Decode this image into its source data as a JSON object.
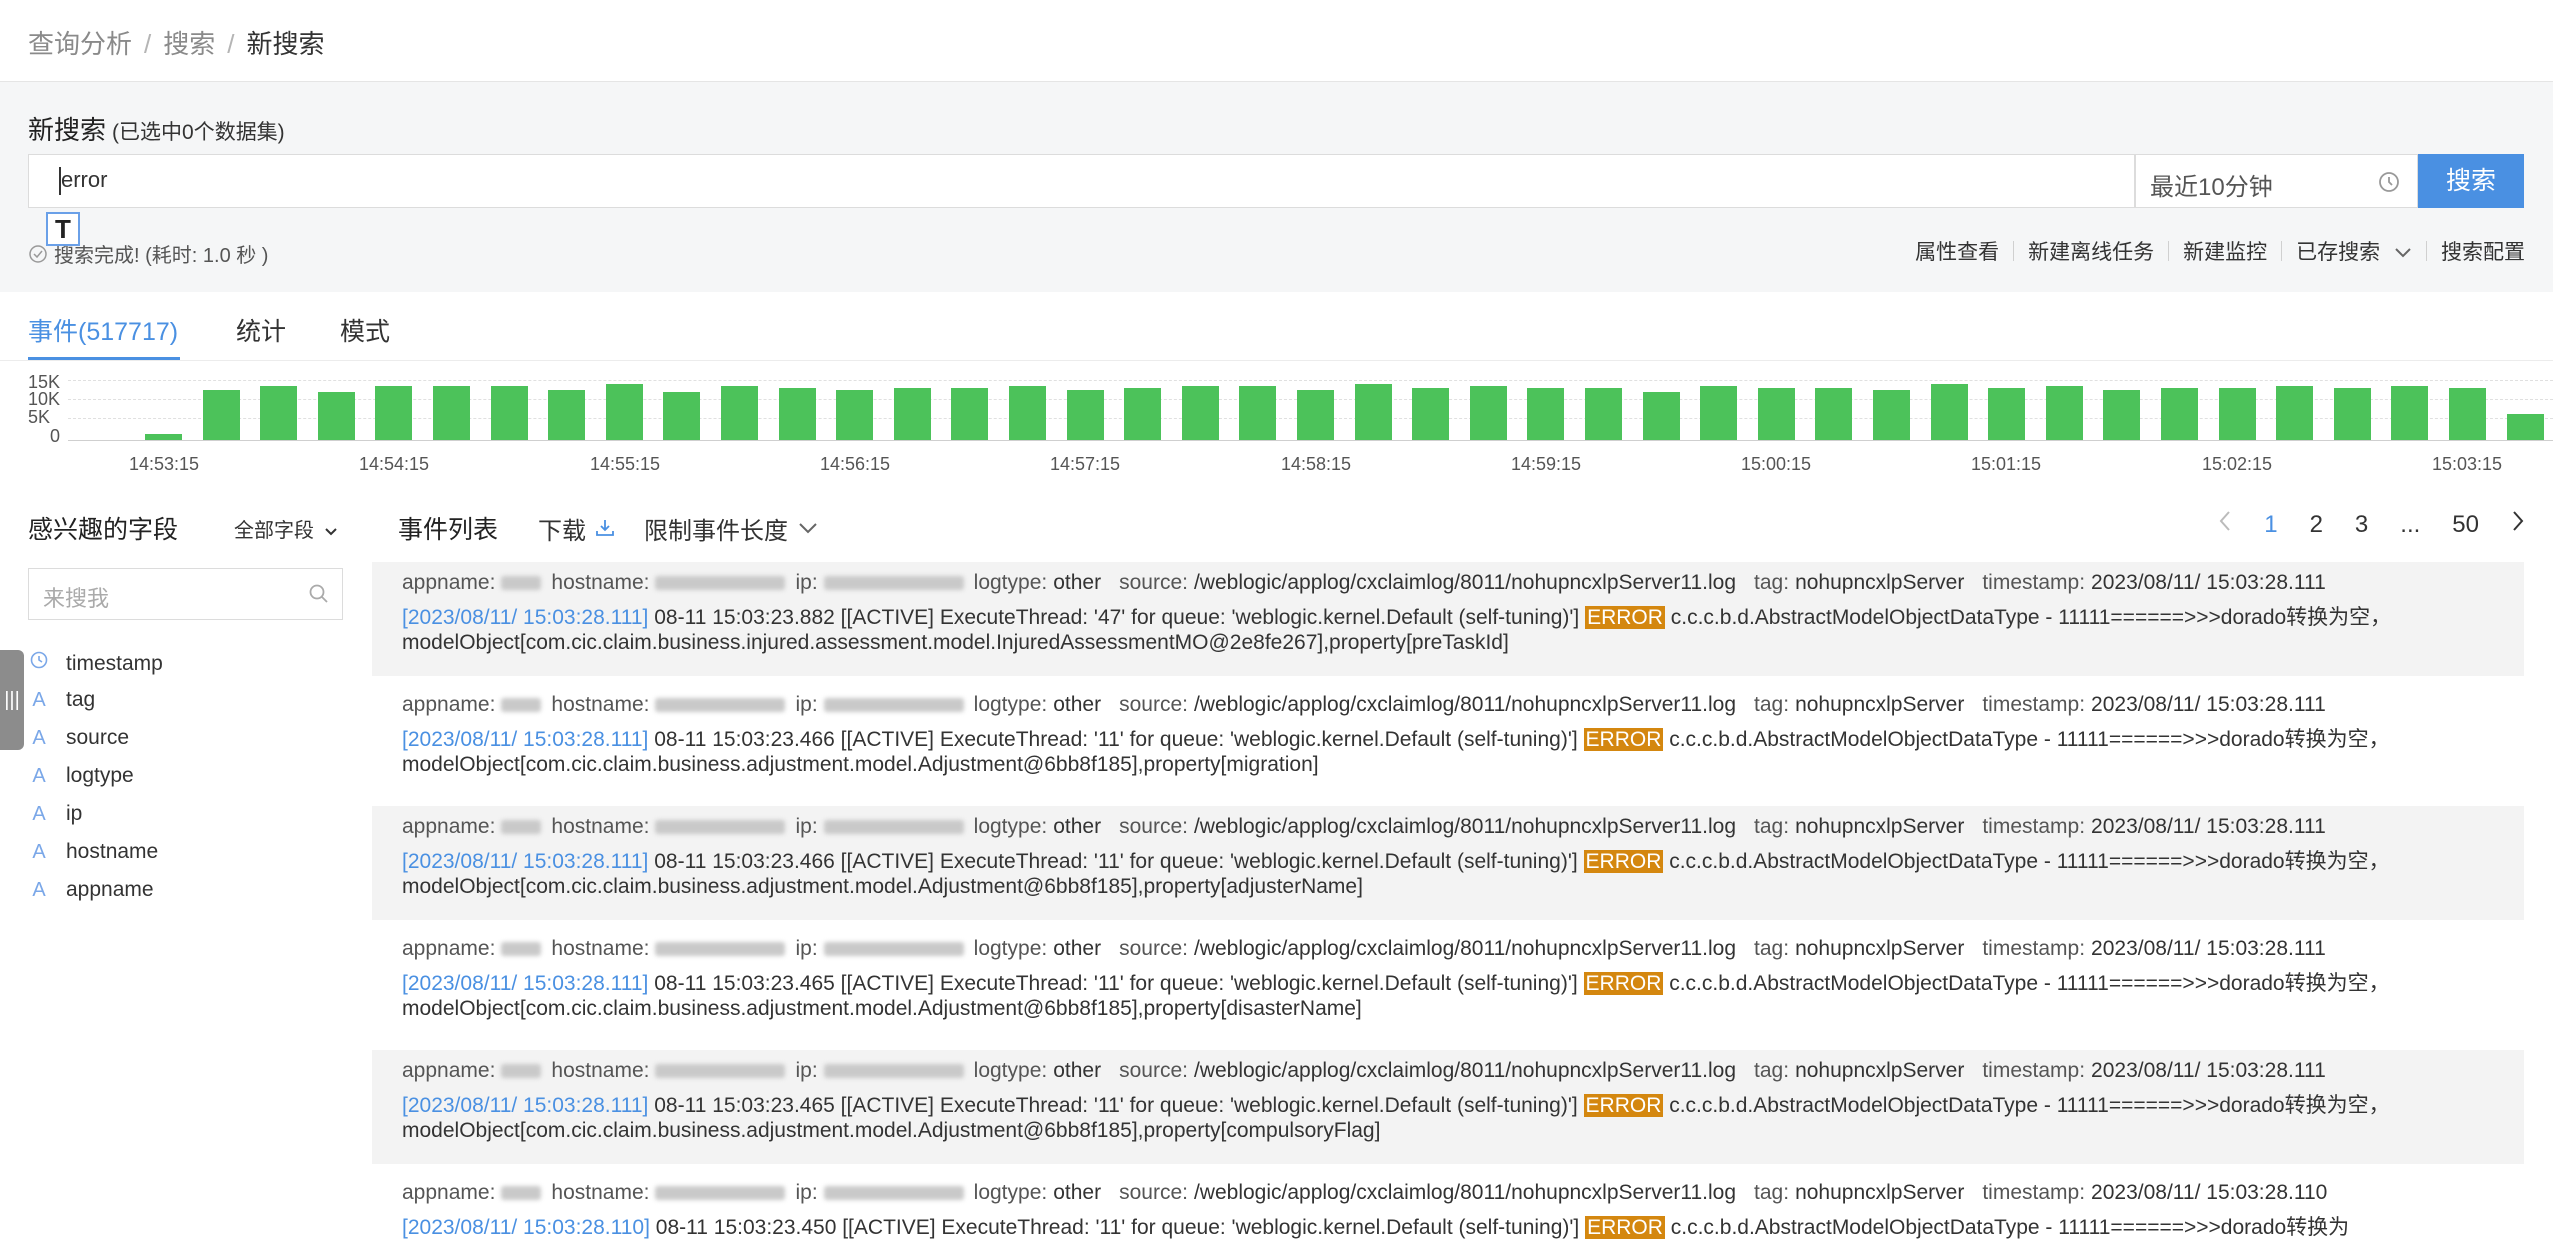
{
  "breadcrumb": {
    "item1": "查询分析",
    "item2": "搜索",
    "current": "新搜索",
    "sep": "/"
  },
  "search": {
    "title": "新搜索",
    "subtitle": "(已选中0个数据集)",
    "query": "error",
    "time_range": "最近10分钟",
    "button": "搜索",
    "status": "搜索完成! (耗时: 1.0 秒 )",
    "cursor_glyph": "T"
  },
  "actions": [
    "属性查看",
    "新建离线任务",
    "新建监控",
    "已存搜索",
    "搜索配置"
  ],
  "tabs": {
    "events": "事件(517717)",
    "stats": "统计",
    "pattern": "模式"
  },
  "chart_data": {
    "type": "bar",
    "y_ticks": [
      "15K",
      "10K",
      "5K",
      "0"
    ],
    "ylim": [
      0,
      15000
    ],
    "x_ticks": [
      "14:53:15",
      "14:54:15",
      "14:55:15",
      "14:56:15",
      "14:57:15",
      "14:58:15",
      "14:59:15",
      "15:00:15",
      "15:01:15",
      "15:02:15",
      "15:03:15"
    ],
    "values": [
      1500,
      12500,
      13500,
      12000,
      13500,
      13500,
      13500,
      12500,
      14000,
      12000,
      13500,
      13000,
      12500,
      13000,
      13000,
      13500,
      12500,
      13000,
      13500,
      13500,
      12500,
      14000,
      13000,
      13500,
      13000,
      13000,
      12000,
      13500,
      13000,
      13000,
      12500,
      14000,
      13000,
      13500,
      12500,
      13000,
      13000,
      13500,
      13000,
      13500,
      13000,
      6500
    ],
    "color": "#4cc25a"
  },
  "fields": {
    "title": "感兴趣的字段",
    "all": "全部字段",
    "search_placeholder": "来搜我",
    "items": [
      {
        "icon": "clock-icon",
        "label": "timestamp"
      },
      {
        "icon": "A",
        "label": "tag"
      },
      {
        "icon": "A",
        "label": "source"
      },
      {
        "icon": "A",
        "label": "logtype"
      },
      {
        "icon": "A",
        "label": "ip"
      },
      {
        "icon": "A",
        "label": "hostname"
      },
      {
        "icon": "A",
        "label": "appname"
      }
    ],
    "handle": "|||"
  },
  "events_header": {
    "title": "事件列表",
    "download": "下载",
    "limit": "限制事件长度"
  },
  "pagination": {
    "pages": [
      "1",
      "2",
      "3",
      "...",
      "50"
    ],
    "active": "1"
  },
  "events": [
    {
      "logtype": "other",
      "source": "/weblogic/applog/cxclaimlog/8011/nohupncxlpServer11.log",
      "tag": "nohupncxlpServer",
      "timestamp": "2023/08/11/ 15:03:28.111",
      "ts": "[2023/08/11/ 15:03:28.111]",
      "pre": " 08-11 15:03:23.882 [[ACTIVE] ExecuteThread: '47' for queue: 'weblogic.kernel.Default (self-tuning)'] ",
      "level": "ERROR",
      "post": " c.c.c.b.d.AbstractModelObjectDataType - 11111======>>>dorado转换为空，modelObject[com.cic.claim.business.injured.assessment.model.InjuredAssessmentMO@2e8fe267],property[preTaskId]"
    },
    {
      "logtype": "other",
      "source": "/weblogic/applog/cxclaimlog/8011/nohupncxlpServer11.log",
      "tag": "nohupncxlpServer",
      "timestamp": "2023/08/11/ 15:03:28.111",
      "ts": "[2023/08/11/ 15:03:28.111]",
      "pre": " 08-11 15:03:23.466 [[ACTIVE] ExecuteThread: '11' for queue: 'weblogic.kernel.Default (self-tuning)'] ",
      "level": "ERROR",
      "post": " c.c.c.b.d.AbstractModelObjectDataType - 11111======>>>dorado转换为空，modelObject[com.cic.claim.business.adjustment.model.Adjustment@6bb8f185],property[migration]"
    },
    {
      "logtype": "other",
      "source": "/weblogic/applog/cxclaimlog/8011/nohupncxlpServer11.log",
      "tag": "nohupncxlpServer",
      "timestamp": "2023/08/11/ 15:03:28.111",
      "ts": "[2023/08/11/ 15:03:28.111]",
      "pre": " 08-11 15:03:23.466 [[ACTIVE] ExecuteThread: '11' for queue: 'weblogic.kernel.Default (self-tuning)'] ",
      "level": "ERROR",
      "post": " c.c.c.b.d.AbstractModelObjectDataType - 11111======>>>dorado转换为空，modelObject[com.cic.claim.business.adjustment.model.Adjustment@6bb8f185],property[adjusterName]"
    },
    {
      "logtype": "other",
      "source": "/weblogic/applog/cxclaimlog/8011/nohupncxlpServer11.log",
      "tag": "nohupncxlpServer",
      "timestamp": "2023/08/11/ 15:03:28.111",
      "ts": "[2023/08/11/ 15:03:28.111]",
      "pre": " 08-11 15:03:23.465 [[ACTIVE] ExecuteThread: '11' for queue: 'weblogic.kernel.Default (self-tuning)'] ",
      "level": "ERROR",
      "post": " c.c.c.b.d.AbstractModelObjectDataType - 11111======>>>dorado转换为空，modelObject[com.cic.claim.business.adjustment.model.Adjustment@6bb8f185],property[disasterName]"
    },
    {
      "logtype": "other",
      "source": "/weblogic/applog/cxclaimlog/8011/nohupncxlpServer11.log",
      "tag": "nohupncxlpServer",
      "timestamp": "2023/08/11/ 15:03:28.111",
      "ts": "[2023/08/11/ 15:03:28.111]",
      "pre": " 08-11 15:03:23.465 [[ACTIVE] ExecuteThread: '11' for queue: 'weblogic.kernel.Default (self-tuning)'] ",
      "level": "ERROR",
      "post": " c.c.c.b.d.AbstractModelObjectDataType - 11111======>>>dorado转换为空，modelObject[com.cic.claim.business.adjustment.model.Adjustment@6bb8f185],property[compulsoryFlag]"
    },
    {
      "logtype": "other",
      "source": "/weblogic/applog/cxclaimlog/8011/nohupncxlpServer11.log",
      "tag": "nohupncxlpServer",
      "timestamp": "2023/08/11/ 15:03:28.110",
      "ts": "[2023/08/11/ 15:03:28.110]",
      "pre": " 08-11 15:03:23.450 [[ACTIVE] ExecuteThread: '11' for queue: 'weblogic.kernel.Default (self-tuning)'] ",
      "level": "ERROR",
      "post": " c.c.c.b.d.AbstractModelObjectDataType - 11111======>>>dorado转换为"
    }
  ],
  "labels": {
    "appname": "appname:",
    "hostname": "hostname:",
    "ip": "ip:",
    "logtype": "logtype:",
    "source": "source:",
    "tag": "tag:",
    "timestamp": "timestamp:"
  }
}
